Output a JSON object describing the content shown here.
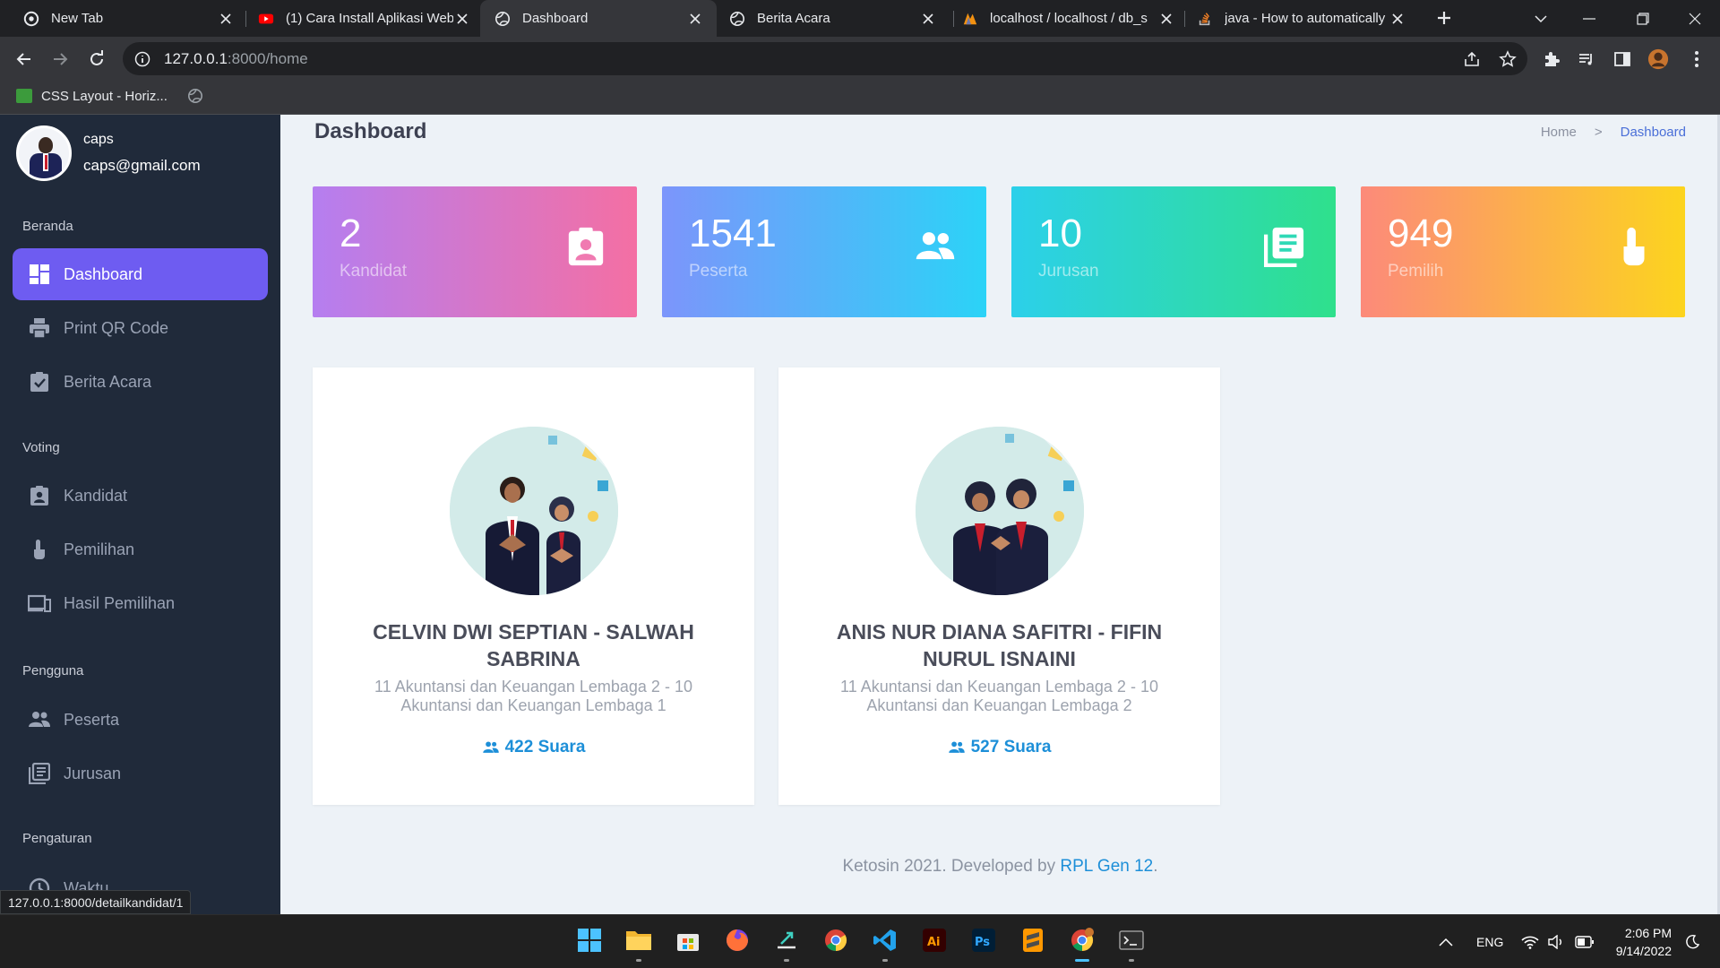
{
  "browser": {
    "tabs": [
      {
        "title": "New Tab",
        "icon": "chrome-icon"
      },
      {
        "title": "(1) Cara Install Aplikasi Web",
        "icon": "youtube-icon"
      },
      {
        "title": "Dashboard",
        "icon": "globe-icon",
        "active": true
      },
      {
        "title": "Berita Acara",
        "icon": "globe-icon"
      },
      {
        "title": "localhost / localhost / db_s",
        "icon": "phpmyadmin-icon"
      },
      {
        "title": "java - How to automatically",
        "icon": "stackoverflow-icon"
      }
    ],
    "url_host": "127.0.0.1",
    "url_path": ":8000/home",
    "bookmark": "CSS Layout - Horiz...",
    "status_url": "127.0.0.1:8000/detailkandidat/1"
  },
  "sidebar": {
    "user_name": "caps",
    "user_email": "caps@gmail.com",
    "sections": {
      "beranda": "Beranda",
      "voting": "Voting",
      "pengguna": "Pengguna",
      "pengaturan": "Pengaturan"
    },
    "items": [
      {
        "label": "Dashboard",
        "icon": "dashboard-icon",
        "active": true
      },
      {
        "label": "Print QR Code",
        "icon": "printer-icon"
      },
      {
        "label": "Berita Acara",
        "icon": "clipboard-check-icon"
      },
      {
        "label": "Kandidat",
        "icon": "id-badge-icon"
      },
      {
        "label": "Pemilihan",
        "icon": "hand-pointer-icon"
      },
      {
        "label": "Hasil Pemilihan",
        "icon": "devices-icon"
      },
      {
        "label": "Peserta",
        "icon": "users-icon"
      },
      {
        "label": "Jurusan",
        "icon": "list-icon"
      },
      {
        "label": "Waktu",
        "icon": "clock-icon"
      }
    ]
  },
  "page": {
    "title": "Dashboard",
    "breadcrumb_home": "Home",
    "breadcrumb_sep": ">",
    "breadcrumb_current": "Dashboard"
  },
  "stats": [
    {
      "value": "2",
      "label": "Kandidat",
      "icon": "id-badge-icon"
    },
    {
      "value": "1541",
      "label": "Peserta",
      "icon": "users-icon"
    },
    {
      "value": "10",
      "label": "Jurusan",
      "icon": "list-icon"
    },
    {
      "value": "949",
      "label": "Pemilih",
      "icon": "hand-pointer-icon"
    }
  ],
  "candidates": [
    {
      "name": "CELVIN DWI SEPTIAN - SALWAH SABRINA",
      "classes": "11 Akuntansi dan Keuangan Lembaga 2 - 10 Akuntansi dan Keuangan Lembaga 1",
      "votes": "422 Suara"
    },
    {
      "name": "ANIS NUR DIANA SAFITRI - FIFIN NURUL ISNAINI",
      "classes": "11 Akuntansi dan Keuangan Lembaga 2 - 10 Akuntansi dan Keuangan Lembaga 2",
      "votes": "527 Suara"
    }
  ],
  "footer": {
    "text": "Ketosin 2021. Developed by ",
    "link": "RPL Gen 12",
    "end": "."
  },
  "taskbar": {
    "apps": [
      "windows-start-icon",
      "file-explorer-icon",
      "microsoft-store-icon",
      "firefox-icon",
      "teamviewer-icon",
      "chrome-icon",
      "vscode-icon",
      "illustrator-icon",
      "photoshop-icon",
      "sublime-text-icon",
      "chrome-profile-icon",
      "terminal-icon"
    ],
    "language": "ENG",
    "time": "2:06 PM",
    "date": "9/14/2022"
  }
}
